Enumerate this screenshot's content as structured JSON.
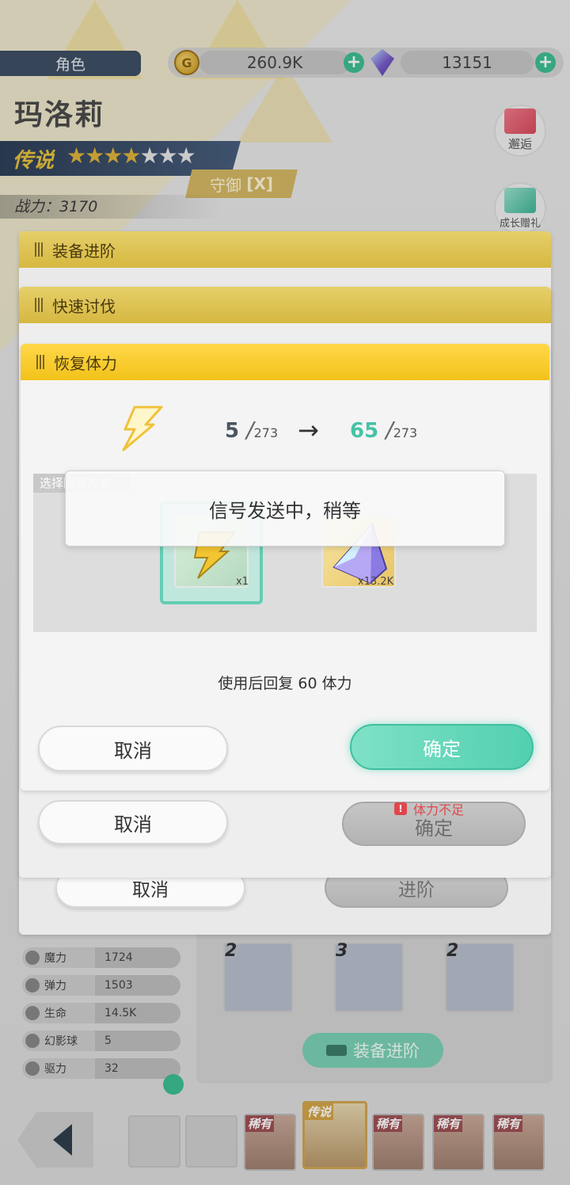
{
  "header": {
    "role_tab": "角色",
    "gold_amount": "260.9K",
    "gem_amount": "13151",
    "plus_symbol": "+"
  },
  "character": {
    "name": "玛洛莉",
    "rarity": "传说",
    "stars_filled": 4,
    "stars_total": 7,
    "role_type": "守御",
    "role_mark": "[X]",
    "power": "战力：3170"
  },
  "side_buttons": {
    "encounter": "邂逅",
    "growth_gift": "成长赠礼"
  },
  "panels": {
    "equip_upgrade": {
      "title": "装备进阶",
      "cancel": "取消",
      "upgrade": "进阶"
    },
    "quick_battle": {
      "title": "快速讨伐",
      "cancel": "取消",
      "confirm": "确定",
      "warning": "体力不足"
    },
    "restore_stamina": {
      "title": "恢复体力",
      "current_value": "5",
      "max_value": "273",
      "result_value": "65",
      "slash": "/",
      "arrow": "→",
      "method_label": "选择回复方式",
      "items": [
        {
          "name": "stamina-potion",
          "count": "x1"
        },
        {
          "name": "diamond",
          "count": "x13.2K"
        }
      ],
      "info": "使用后回复 60 体力",
      "cancel": "取消",
      "confirm": "确定"
    }
  },
  "toast": {
    "message": "信号发送中，稍等"
  },
  "stats": [
    {
      "name": "魔力",
      "value": "1724",
      "icon": "magic-icon"
    },
    {
      "name": "弹力",
      "value": "1503",
      "icon": "elasticity-icon"
    },
    {
      "name": "生命",
      "value": "14.5K",
      "icon": "heart-icon"
    },
    {
      "name": "幻影球",
      "value": "5",
      "icon": "orb-icon"
    },
    {
      "name": "驱力",
      "value": "32",
      "icon": "drive-icon"
    }
  ],
  "equipment": {
    "items": [
      {
        "level": "2",
        "name": "staff"
      },
      {
        "level": "3",
        "name": "shield"
      },
      {
        "level": "2",
        "name": "totem"
      }
    ],
    "button": "装备进阶"
  },
  "roster": [
    {
      "tag": "传说",
      "selected": true
    },
    {
      "tag": "稀有",
      "selected": false
    },
    {
      "tag": "稀有",
      "selected": false
    },
    {
      "tag": "稀有",
      "selected": false
    },
    {
      "tag": "稀有",
      "selected": false
    },
    {
      "tag": "稀有",
      "selected": false
    }
  ],
  "colors": {
    "accent_yellow": "#f2c21a",
    "accent_green": "#52d0b0",
    "warning_red": "#e0474c"
  }
}
